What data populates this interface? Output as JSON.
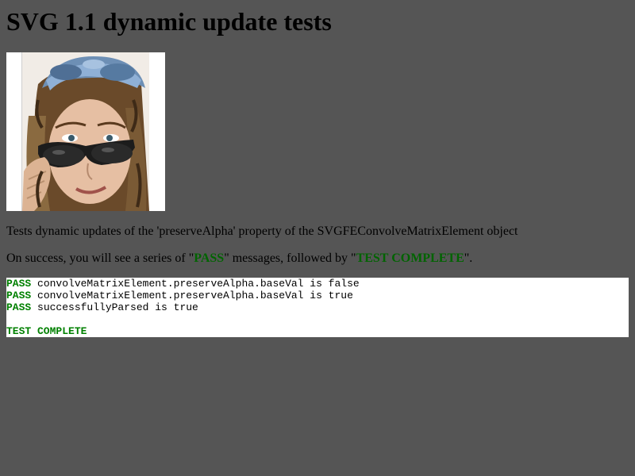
{
  "page": {
    "title": "SVG 1.1 dynamic update tests",
    "description": "Tests dynamic updates of the 'preserveAlpha' property of the SVGFEConvolveMatrixElement object",
    "success_prefix": "On success, you will see a series of \"",
    "success_pass": "PASS",
    "success_middle": "\" messages, followed by \"",
    "success_complete": "TEST COMPLETE",
    "success_suffix": "\"."
  },
  "image": {
    "icon": "woman-with-sunglasses-photo"
  },
  "console": {
    "results": [
      {
        "status": "PASS",
        "message": " convolveMatrixElement.preserveAlpha.baseVal is false"
      },
      {
        "status": "PASS",
        "message": " convolveMatrixElement.preserveAlpha.baseVal is true"
      },
      {
        "status": "PASS",
        "message": " successfullyParsed is true"
      }
    ],
    "complete": "TEST COMPLETE"
  },
  "colors": {
    "background": "#555555",
    "pass_green": "#008000",
    "highlight_green": "#006400"
  }
}
